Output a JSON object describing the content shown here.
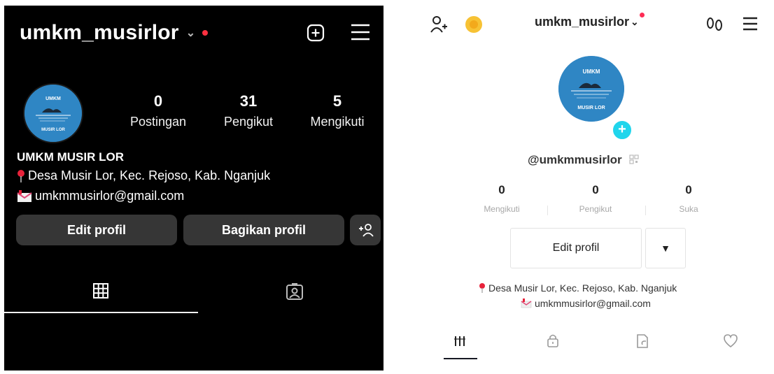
{
  "instagram": {
    "username": "umkm_musirlor",
    "stats": [
      {
        "value": "0",
        "label": "Postingan"
      },
      {
        "value": "31",
        "label": "Pengikut"
      },
      {
        "value": "5",
        "label": "Mengikuti"
      }
    ],
    "bio": {
      "name": "UMKM MUSIR LOR",
      "location": "Desa Musir Lor, Kec. Rejoso, Kab. Nganjuk",
      "email": "umkmmusirlor@gmail.com"
    },
    "buttons": {
      "edit": "Edit profil",
      "share": "Bagikan profil"
    },
    "colors": {
      "background": "#000000",
      "button": "#363636",
      "notification": "#ff3040"
    }
  },
  "tiktok": {
    "username": "umkm_musirlor",
    "handle": "@umkmmusirlor",
    "stats": [
      {
        "value": "0",
        "label": "Mengikuti"
      },
      {
        "value": "0",
        "label": "Pengikut"
      },
      {
        "value": "0",
        "label": "Suka"
      }
    ],
    "buttons": {
      "edit": "Edit profil"
    },
    "bio": {
      "location": "Desa Musir Lor, Kec. Rejoso, Kab. Nganjuk",
      "email": "umkmmusirlor@gmail.com"
    },
    "colors": {
      "accent": "#fe2c55",
      "avatar_plus": "#20d5ec",
      "coin": "#f7c234"
    }
  },
  "avatar": {
    "text_top": "UMKM",
    "text_bottom": "MUSIR LOR",
    "color": "#2f86c4"
  }
}
